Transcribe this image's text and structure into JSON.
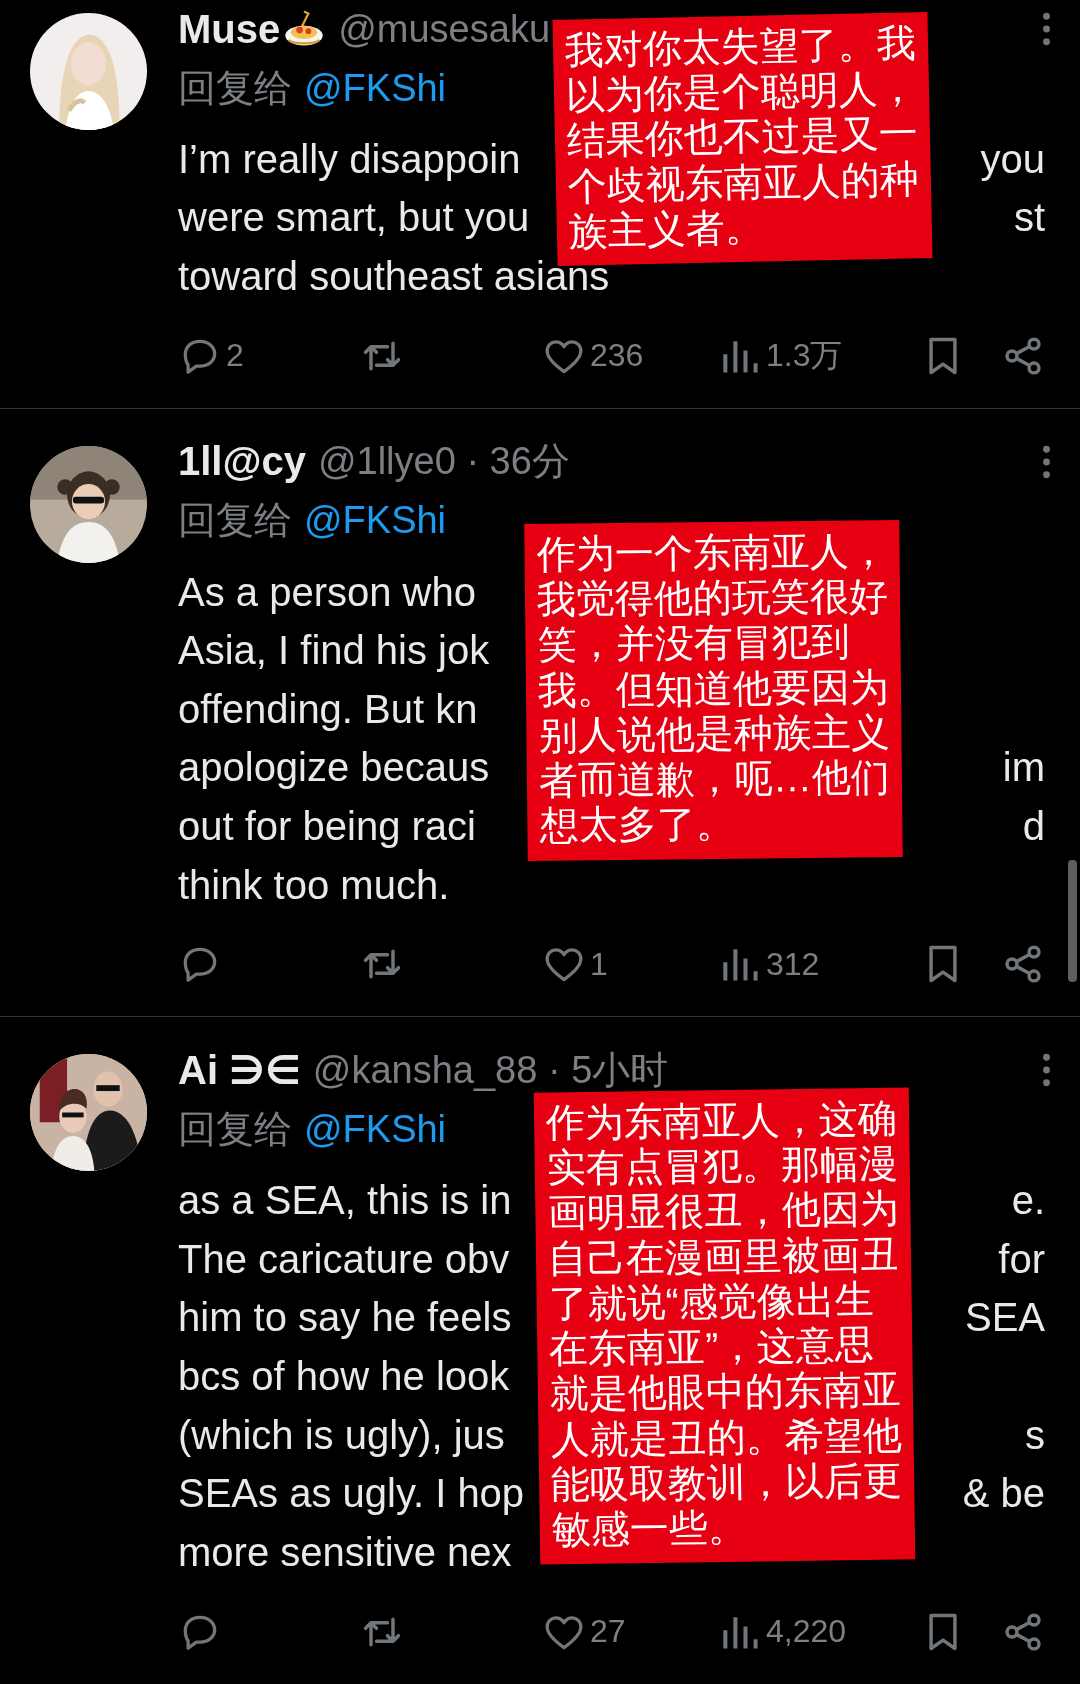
{
  "tweets": [
    {
      "name": "Muse",
      "emoji": true,
      "meta": "@musesaku",
      "reply_label": "回复给",
      "reply_to": "@FKShi",
      "body": [
        {
          "left": "I’m really disappoin",
          "right": "you"
        },
        {
          "left": "were smart, but you",
          "right": "st"
        },
        {
          "left": "toward southeast asians"
        }
      ],
      "replies": "2",
      "likes": "236",
      "views": "1.3万",
      "note": [
        "我对你太失望了。我",
        "以为你是个聪明人，",
        "结果你也不过是又一",
        "个歧视东南亚人的种",
        "族主义者。"
      ]
    },
    {
      "name": "1ll@cy",
      "meta": "@1llye0 · 36分",
      "reply_label": "回复给",
      "reply_to": "@FKShi",
      "body": [
        {
          "left": "As a person who"
        },
        {
          "left": "Asia, I find his jok"
        },
        {
          "left": "offending. But kn"
        },
        {
          "left": "apologize becaus",
          "right": "im"
        },
        {
          "left": "out for being raci",
          "right": "d"
        },
        {
          "left": "think too much."
        }
      ],
      "likes": "1",
      "views": "312",
      "note": [
        "作为一个东南亚人，",
        "我觉得他的玩笑很好",
        "笑，并没有冒犯到",
        "我。但知道他要因为",
        "别人说他是种族主义",
        "者而道歉，呃…他们",
        "想太多了。"
      ]
    },
    {
      "name": "Ai ∋∈",
      "meta": "@kansha_88 · 5小时",
      "reply_label": "回复给",
      "reply_to": "@FKShi",
      "body": [
        {
          "left": "as a SEA, this is in",
          "right": "e."
        },
        {
          "left": "The caricature obv",
          "right": "for"
        },
        {
          "left": "him to say he feels",
          "right": "SEA"
        },
        {
          "left": "bcs of how he look"
        },
        {
          "left": "(which is ugly), jus",
          "right": "s"
        },
        {
          "left": "SEAs as ugly. I hop",
          "right": "& be"
        },
        {
          "left": "more sensitive nex"
        }
      ],
      "likes": "27",
      "views": "4,220",
      "note": [
        "作为东南亚人，这确",
        "实有点冒犯。那幅漫",
        "画明显很丑，他因为",
        "自己在漫画里被画丑",
        "了就说“感觉像出生",
        "在东南亚”，这意思",
        "就是他眼中的东南亚",
        "人就是丑的。希望他",
        "能吸取教训，以后更",
        "敏感一些。"
      ]
    }
  ]
}
